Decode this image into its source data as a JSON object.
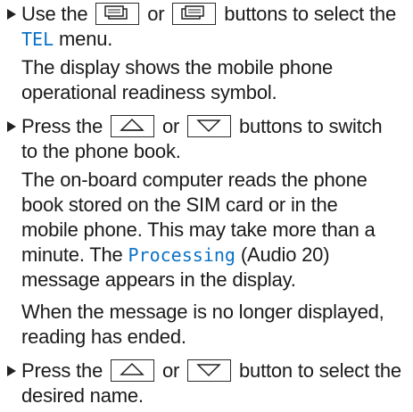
{
  "steps": [
    {
      "lines": [
        {
          "pre": "Use the",
          "mid": "or",
          "post": "buttons to select the"
        },
        {
          "display": "TEL",
          "post": "menu."
        },
        {
          "text": "The display shows the mobile phone"
        },
        {
          "text": "operational readiness symbol."
        }
      ],
      "icons": [
        "page-left-icon",
        "page-right-icon"
      ]
    },
    {
      "lines": [
        {
          "pre": "Press the",
          "mid": "or",
          "post": "buttons to switch"
        },
        {
          "text": "to the phone book."
        },
        {
          "text": "The on-board computer reads the phone"
        },
        {
          "text": "book stored on the SIM card or in the"
        },
        {
          "text": "mobile phone. This may take more than a"
        },
        {
          "pre": "minute. The",
          "display": "Processing",
          "post": "(Audio 20)"
        },
        {
          "text": "message appears in the display."
        },
        {
          "text": "When the message is no longer displayed,"
        },
        {
          "text": "reading has ended."
        }
      ],
      "icons": [
        "arrow-up-icon",
        "arrow-down-icon"
      ]
    },
    {
      "lines": [
        {
          "pre": "Press the",
          "mid": "or",
          "post": "button to select the"
        },
        {
          "text": "desired name."
        }
      ],
      "icons": [
        "arrow-up-icon",
        "arrow-down-icon"
      ]
    }
  ]
}
